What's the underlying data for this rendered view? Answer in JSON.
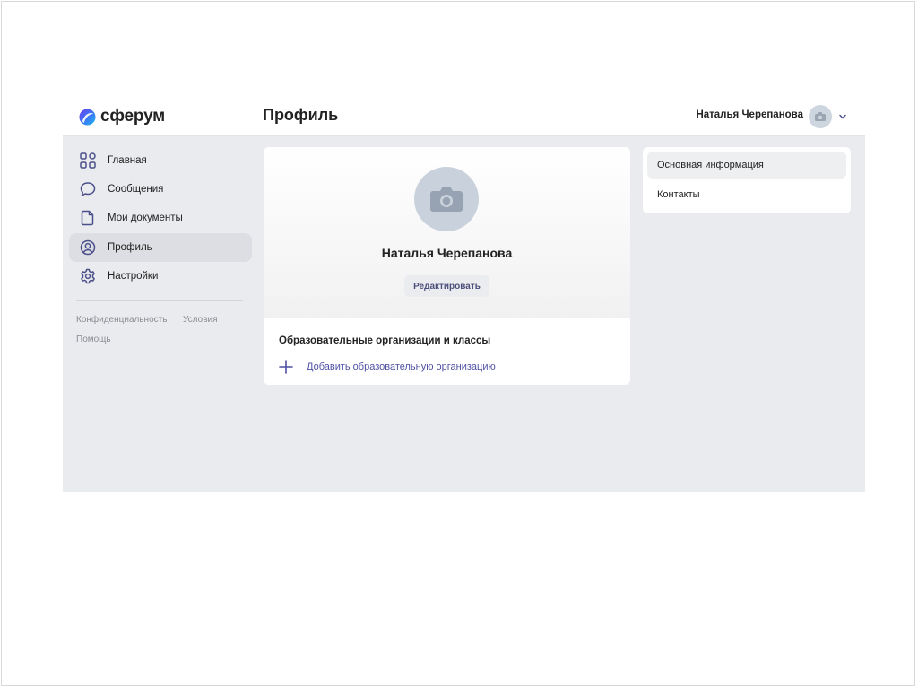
{
  "brand": {
    "name": "сферум"
  },
  "header": {
    "title": "Профиль",
    "user_name": "Наталья Черепанова"
  },
  "sidebar": {
    "items": [
      {
        "label": "Главная",
        "icon": "grid-icon",
        "active": false
      },
      {
        "label": "Сообщения",
        "icon": "chat-bubble-icon",
        "active": false
      },
      {
        "label": "Мои документы",
        "icon": "document-icon",
        "active": false
      },
      {
        "label": "Профиль",
        "icon": "user-circle-icon",
        "active": true
      },
      {
        "label": "Настройки",
        "icon": "gear-icon",
        "active": false
      }
    ],
    "footer_links": {
      "privacy": "Конфиденциальность",
      "terms": "Условия",
      "help": "Помощь"
    }
  },
  "profile": {
    "name": "Наталья Черепанова",
    "edit_label": "Редактировать",
    "orgs_title": "Образовательные организации и классы",
    "add_org_label": "Добавить образовательную организацию"
  },
  "info_menu": {
    "items": [
      {
        "label": "Основная информация",
        "active": true
      },
      {
        "label": "Контакты",
        "active": false
      }
    ]
  },
  "colors": {
    "accent": "#4e4fa4",
    "icon": "#4b4f8a",
    "background": "#e9ebee",
    "active_nav": "#dcdee3",
    "avatar": "#c9d2dc"
  }
}
